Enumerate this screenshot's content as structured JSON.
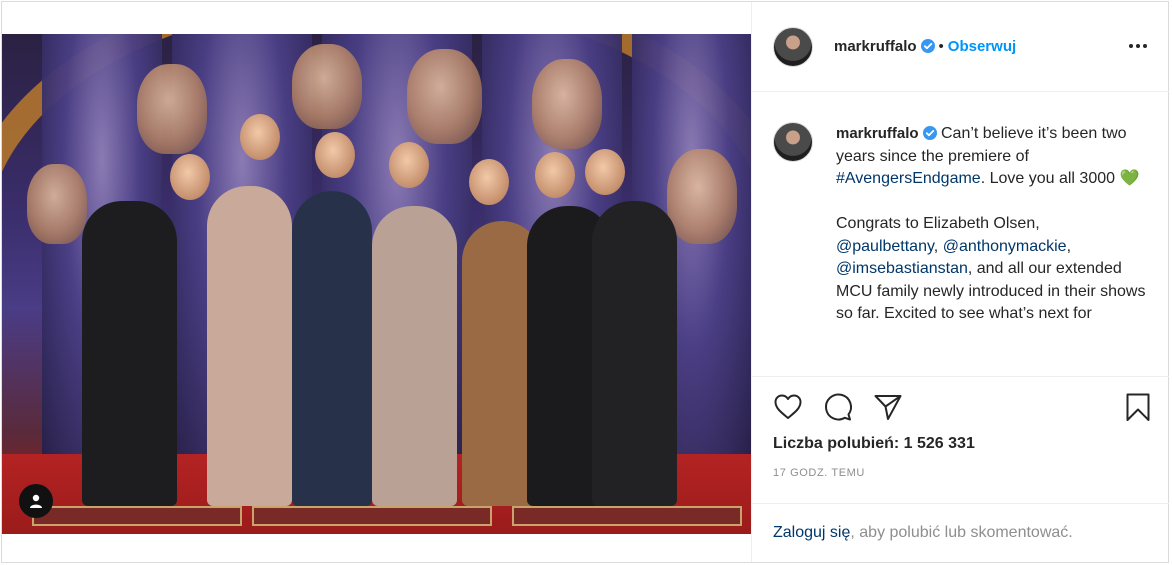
{
  "post": {
    "username": "markruffalo",
    "follow_label": "Obserwuj",
    "separator": "•",
    "caption": {
      "line1": "Can’t believe it’s been two years since the premiere of",
      "hashtag": "#AvengersEndgame",
      "line2": ". Love you all 3000",
      "emoji": "💚",
      "para2_start": "Congrats to Elizabeth Olsen,",
      "mention1": "@paulbettany",
      "comma": ",",
      "mention2": "@anthonymackie",
      "mention3": "@imsebastianstan",
      "para2_end": ", and all our extended MCU family newly introduced in their shows so far. Excited to see what’s next for"
    },
    "likes_label": "Liczba polubień: 1 526 331",
    "timestamp": "17 GODZ. TEMU",
    "login": {
      "link": "Zaloguj się",
      "rest": ", aby polubić lub skomentować."
    }
  },
  "icons": {
    "verified": "verified-badge-icon",
    "more": "more-options-icon",
    "like": "heart-icon",
    "comment": "comment-icon",
    "share": "share-icon",
    "save": "bookmark-icon",
    "user_tag": "user-tag-icon"
  },
  "colors": {
    "accent": "#0095f6",
    "link": "#00376b",
    "muted": "#8e8e8e",
    "text": "#262626",
    "border": "#dbdbdb"
  }
}
